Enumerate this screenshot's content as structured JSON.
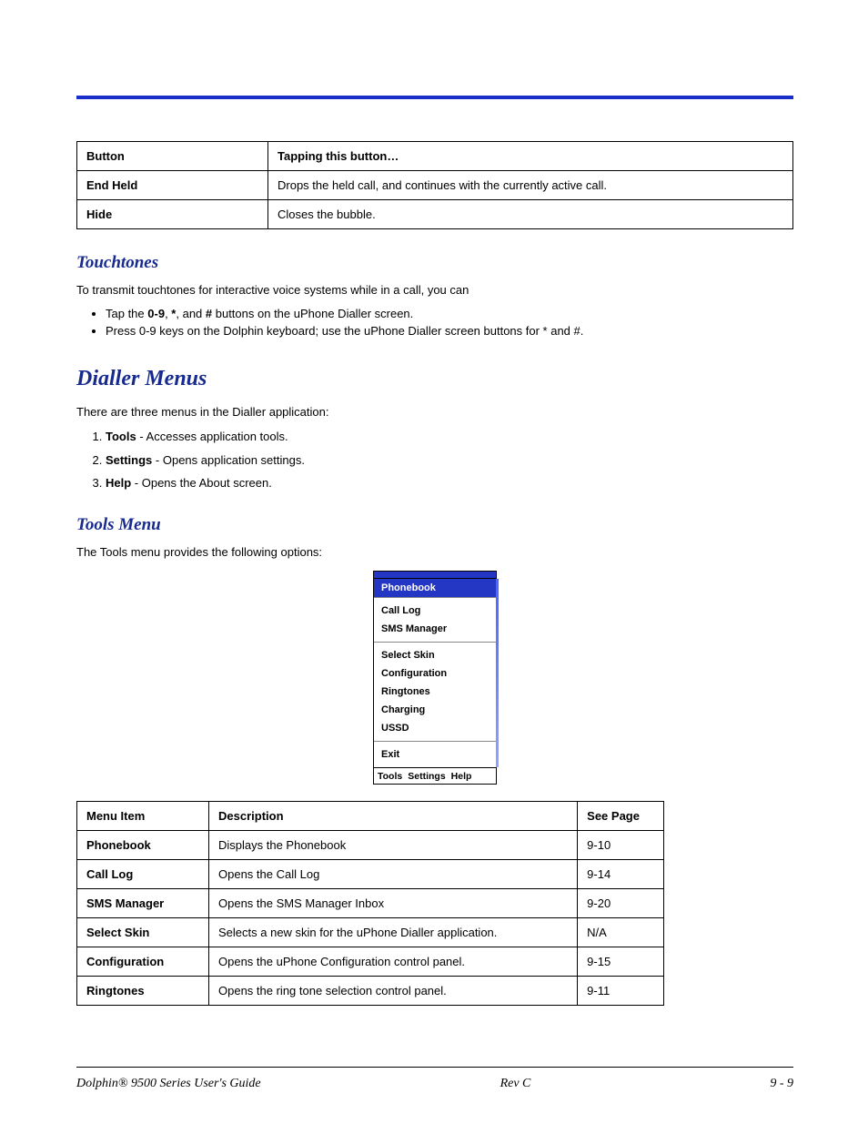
{
  "button_table": {
    "headers": [
      "Button",
      "Tapping this button…"
    ],
    "rows": [
      [
        "End Held",
        "Drops the held call, and continues with the currently active call."
      ],
      [
        "Hide",
        "Closes the bubble."
      ]
    ]
  },
  "touchtones": {
    "heading": "Touchtones",
    "intro": "To transmit touchtones for interactive voice systems while in a call, you can",
    "bullets": [
      {
        "pre": "Tap the ",
        "b1": "0-9",
        "mid1": ", ",
        "b2": "*",
        "mid2": ", and ",
        "b3": "#",
        "post": " buttons on the uPhone Dialler screen."
      },
      {
        "text": "Press 0-9 keys on the Dolphin keyboard; use the uPhone Dialler screen buttons for * and #."
      }
    ]
  },
  "dialler": {
    "heading": "Dialler Menus",
    "intro": "There are three menus in the Dialler application:",
    "items": [
      {
        "b": "Tools",
        "t": " - Accesses application tools."
      },
      {
        "b": "Settings",
        "t": " - Opens application settings."
      },
      {
        "b": "Help",
        "t": " - Opens the About screen."
      }
    ]
  },
  "tools": {
    "heading": "Tools Menu",
    "intro": "The Tools menu provides the following options:",
    "menu": {
      "selected": "Phonebook",
      "group1": [
        "Call Log",
        "SMS Manager"
      ],
      "group2": [
        "Select Skin",
        "Configuration",
        "Ringtones",
        "Charging",
        "USSD"
      ],
      "group3": [
        "Exit"
      ],
      "bar": [
        "Tools",
        "Settings",
        "Help"
      ]
    },
    "table": {
      "headers": [
        "Menu Item",
        "Description",
        "See Page"
      ],
      "rows": [
        [
          "Phonebook",
          "Displays the Phonebook",
          "9-10"
        ],
        [
          "Call Log",
          "Opens the Call Log",
          "9-14"
        ],
        [
          "SMS Manager",
          "Opens the SMS Manager Inbox",
          "9-20"
        ],
        [
          "Select Skin",
          "Selects a new skin for the uPhone Dialler application.",
          "N/A"
        ],
        [
          "Configuration",
          "Opens the uPhone Configuration control panel.",
          "9-15"
        ],
        [
          "Ringtones",
          "Opens the ring tone selection control panel.",
          "9-11"
        ]
      ]
    }
  },
  "footer": {
    "left": "Dolphin® 9500 Series User's Guide",
    "center": "Rev C",
    "right": "9 - 9"
  }
}
